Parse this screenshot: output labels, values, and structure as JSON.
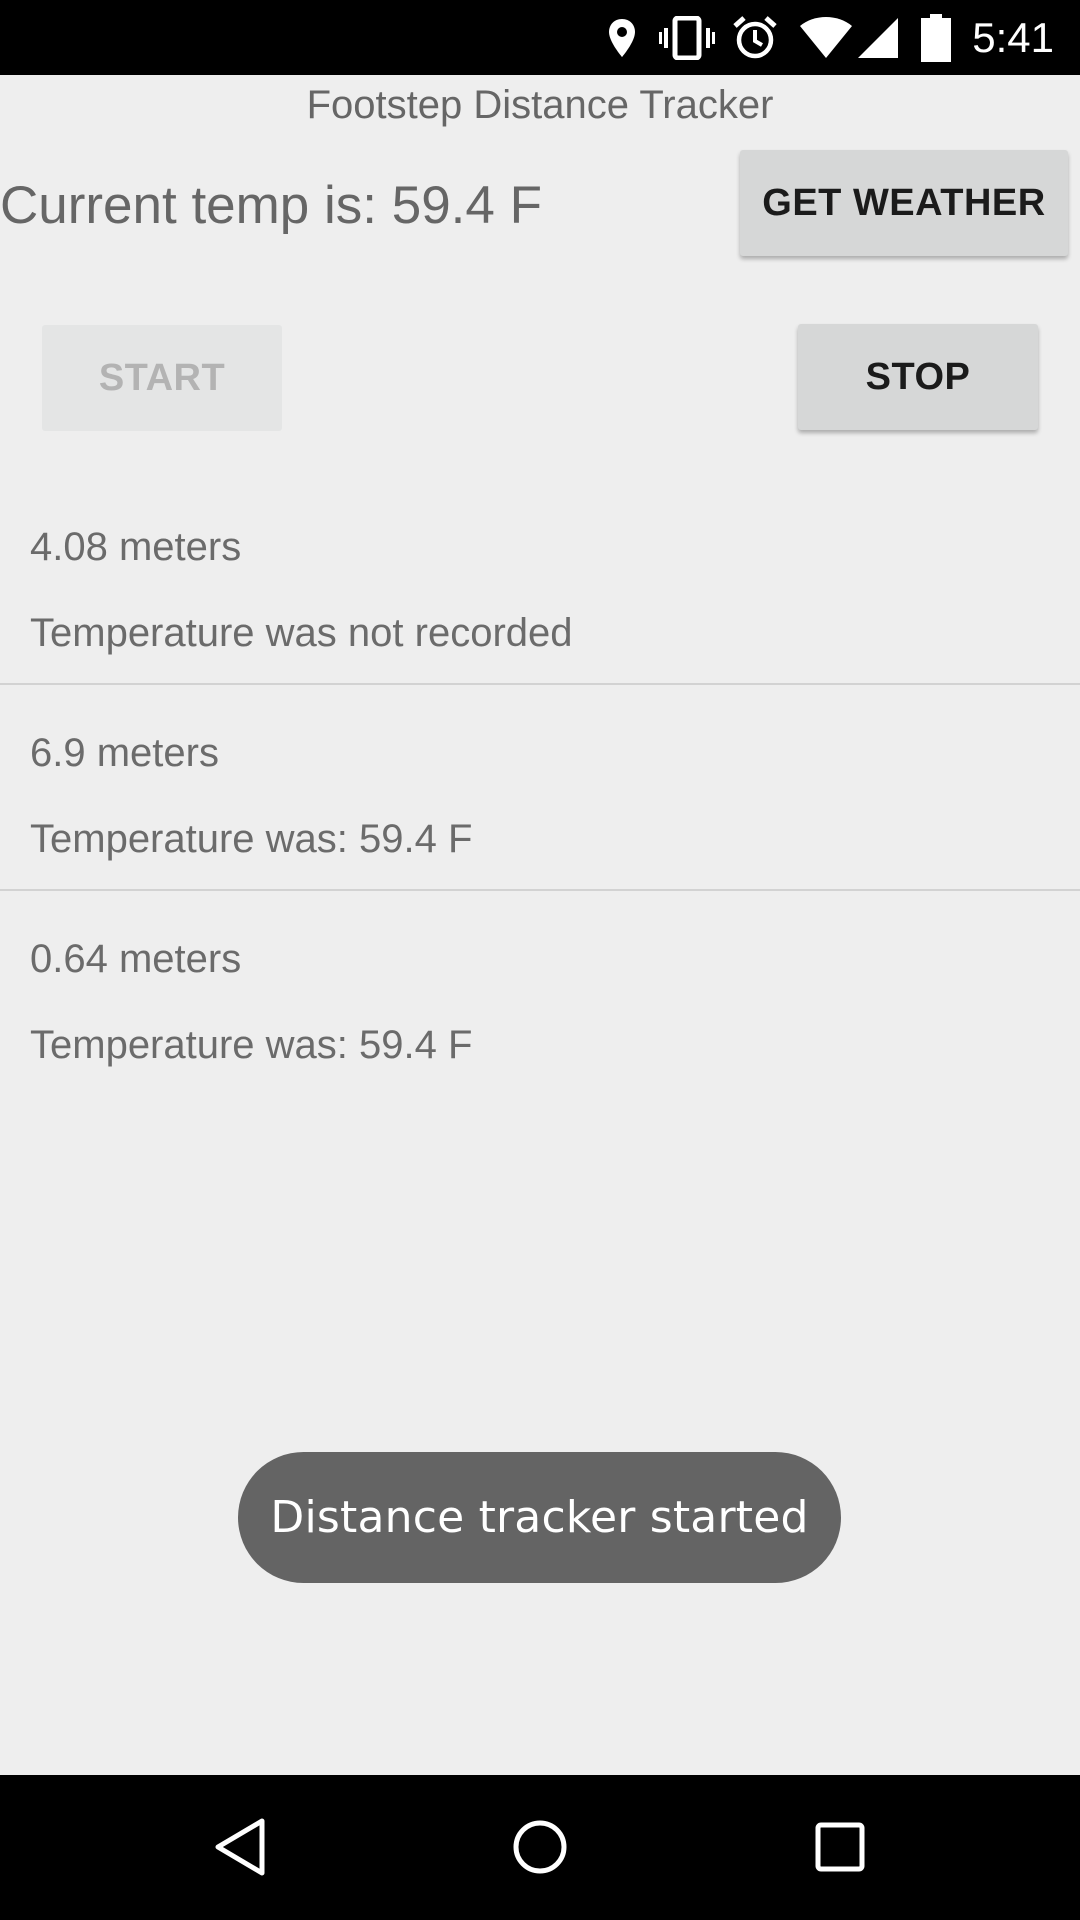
{
  "status_bar": {
    "time": "5:41",
    "icons": [
      "location-icon",
      "vibrate-icon",
      "alarm-icon",
      "wifi-icon",
      "cell-signal-icon",
      "battery-icon"
    ]
  },
  "app": {
    "title": "Footstep Distance Tracker"
  },
  "weather": {
    "current_temp_text": "Current temp is: 59.4 F",
    "get_weather_label": "GET WEATHER"
  },
  "controls": {
    "start_label": "START",
    "start_enabled": false,
    "stop_label": "STOP",
    "stop_enabled": true
  },
  "records": [
    {
      "distance": "4.08 meters",
      "temperature": "Temperature was not recorded"
    },
    {
      "distance": "6.9 meters",
      "temperature": "Temperature was: 59.4 F"
    },
    {
      "distance": "0.64 meters",
      "temperature": "Temperature was: 59.4 F"
    }
  ],
  "toast": {
    "message": "Distance tracker started"
  },
  "nav_bar": {
    "buttons": [
      "back-icon",
      "home-icon",
      "recents-icon"
    ]
  },
  "colors": {
    "background": "#eeeeee",
    "button": "#d6d7d7",
    "button_disabled": "#e4e5e5",
    "toast": "#646464",
    "text": "#666666"
  }
}
